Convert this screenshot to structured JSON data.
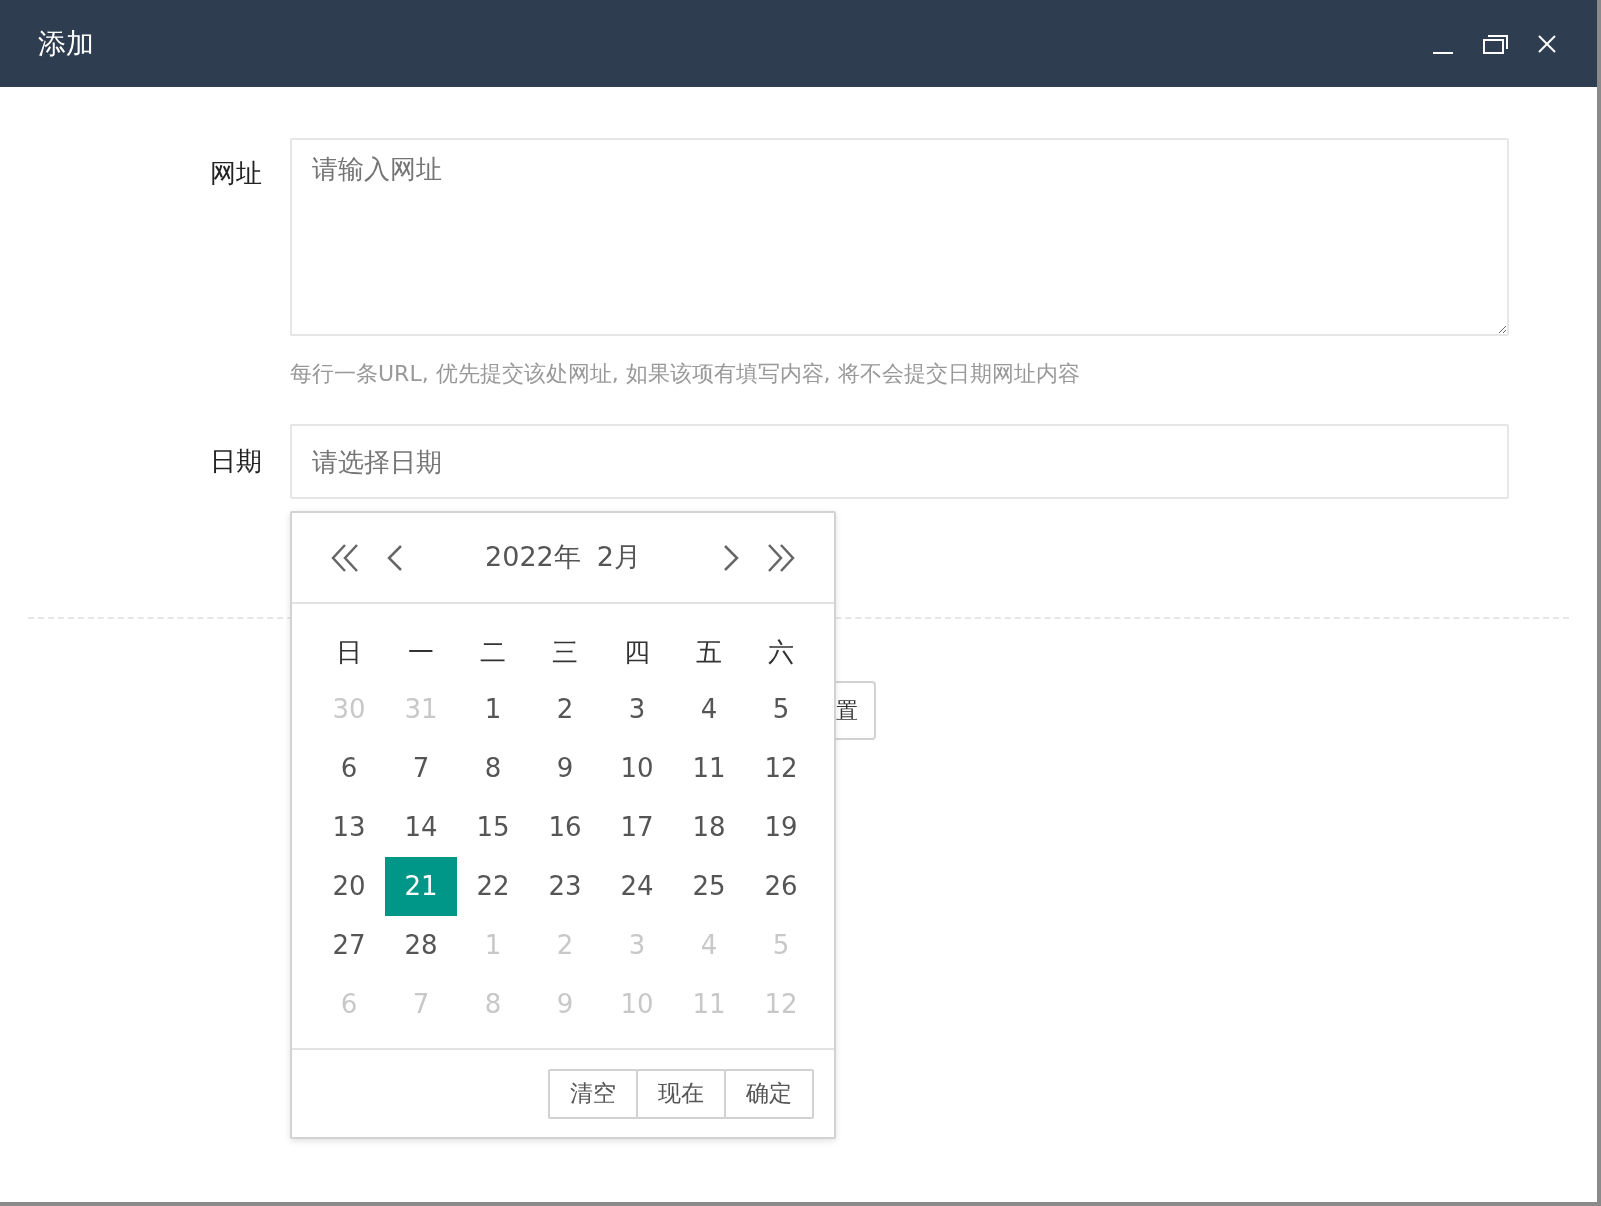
{
  "window": {
    "title": "添加",
    "controls": [
      {
        "kind": "minimize"
      },
      {
        "kind": "maximize"
      },
      {
        "kind": "close"
      }
    ]
  },
  "url_field": {
    "label": "网址",
    "placeholder": "请输入网址",
    "hint": "每行一条URL, 优先提交该处网址, 如果该项有填写内容, 将不会提交日期网址内容"
  },
  "date_field": {
    "label": "日期",
    "placeholder": "请选择日期"
  },
  "buttons": [
    {
      "label": "置"
    }
  ],
  "calendar": {
    "year": "2022年",
    "month": "2月",
    "weekdays": [
      "日",
      "一",
      "二",
      "三",
      "四",
      "五",
      "六"
    ],
    "days": [
      {
        "label": "30",
        "kind": "other",
        "selected": false
      },
      {
        "label": "31",
        "kind": "other",
        "selected": false
      },
      {
        "label": "1",
        "kind": "current",
        "selected": false
      },
      {
        "label": "2",
        "kind": "current",
        "selected": false
      },
      {
        "label": "3",
        "kind": "current",
        "selected": false
      },
      {
        "label": "4",
        "kind": "current",
        "selected": false
      },
      {
        "label": "5",
        "kind": "current",
        "selected": false
      },
      {
        "label": "6",
        "kind": "current",
        "selected": false
      },
      {
        "label": "7",
        "kind": "current",
        "selected": false
      },
      {
        "label": "8",
        "kind": "current",
        "selected": false
      },
      {
        "label": "9",
        "kind": "current",
        "selected": false
      },
      {
        "label": "10",
        "kind": "current",
        "selected": false
      },
      {
        "label": "11",
        "kind": "current",
        "selected": false
      },
      {
        "label": "12",
        "kind": "current",
        "selected": false
      },
      {
        "label": "13",
        "kind": "current",
        "selected": false
      },
      {
        "label": "14",
        "kind": "current",
        "selected": false
      },
      {
        "label": "15",
        "kind": "current",
        "selected": false
      },
      {
        "label": "16",
        "kind": "current",
        "selected": false
      },
      {
        "label": "17",
        "kind": "current",
        "selected": false
      },
      {
        "label": "18",
        "kind": "current",
        "selected": false
      },
      {
        "label": "19",
        "kind": "current",
        "selected": false
      },
      {
        "label": "20",
        "kind": "current",
        "selected": false
      },
      {
        "label": "21",
        "kind": "current",
        "selected": true
      },
      {
        "label": "22",
        "kind": "current",
        "selected": false
      },
      {
        "label": "23",
        "kind": "current",
        "selected": false
      },
      {
        "label": "24",
        "kind": "current",
        "selected": false
      },
      {
        "label": "25",
        "kind": "current",
        "selected": false
      },
      {
        "label": "26",
        "kind": "current",
        "selected": false
      },
      {
        "label": "27",
        "kind": "current",
        "selected": false
      },
      {
        "label": "28",
        "kind": "current",
        "selected": false
      },
      {
        "label": "1",
        "kind": "other",
        "selected": false
      },
      {
        "label": "2",
        "kind": "other",
        "selected": false
      },
      {
        "label": "3",
        "kind": "other",
        "selected": false
      },
      {
        "label": "4",
        "kind": "other",
        "selected": false
      },
      {
        "label": "5",
        "kind": "other",
        "selected": false
      },
      {
        "label": "6",
        "kind": "other",
        "selected": false
      },
      {
        "label": "7",
        "kind": "other",
        "selected": false
      },
      {
        "label": "8",
        "kind": "other",
        "selected": false
      },
      {
        "label": "9",
        "kind": "other",
        "selected": false
      },
      {
        "label": "10",
        "kind": "other",
        "selected": false
      },
      {
        "label": "11",
        "kind": "other",
        "selected": false
      },
      {
        "label": "12",
        "kind": "other",
        "selected": false
      }
    ],
    "buttons": [
      {
        "label": "清空"
      },
      {
        "label": "现在"
      },
      {
        "label": "确定"
      }
    ]
  }
}
